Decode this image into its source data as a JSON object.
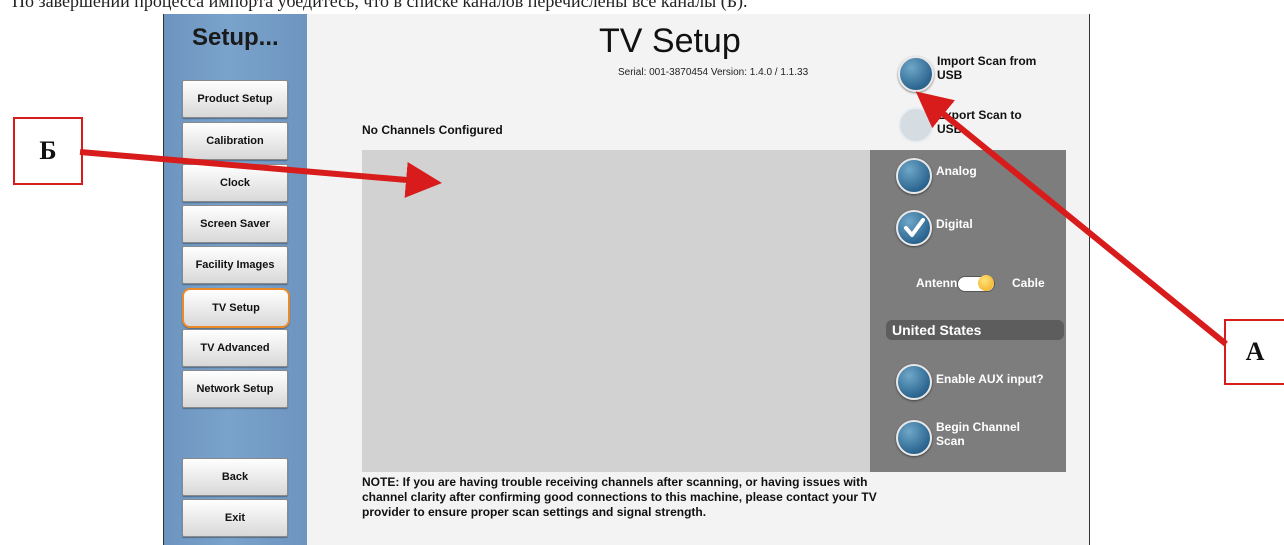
{
  "doc_caption": "По завершении процесса импорта убедитесь, что в списке каналов перечислены все каналы (Б).",
  "sidebar": {
    "title": "Setup...",
    "items": [
      {
        "label": "Product Setup"
      },
      {
        "label": "Calibration"
      },
      {
        "label": "Clock"
      },
      {
        "label": "Screen Saver"
      },
      {
        "label": "Facility Images"
      },
      {
        "label": "TV Setup",
        "active": true
      },
      {
        "label": "TV Advanced"
      },
      {
        "label": "Network Setup"
      }
    ],
    "back_label": "Back",
    "exit_label": "Exit"
  },
  "main": {
    "title": "TV Setup",
    "serial": "Serial: 001-3870454  Version: 1.4.0 / 1.1.33",
    "channels_status": "No Channels Configured",
    "import_label": "Import Scan from USB",
    "export_label": "Export Scan to USB",
    "analog_label": "Analog",
    "digital_label": "Digital",
    "antenna_label": "Antenna",
    "cable_label": "Cable",
    "country": "United States",
    "aux_label": "Enable AUX input?",
    "scan_label": "Begin Channel Scan",
    "note": "NOTE: If you are having trouble receiving channels after scanning, or having issues with channel clarity after confirming good connections to this machine, please contact your TV provider to ensure proper scan settings and signal strength."
  },
  "callouts": {
    "left": "Б",
    "right": "А"
  },
  "colors": {
    "sidebar_blue": "#7aa3cc",
    "active_outline": "#e88a2a",
    "annotation_red": "#d81b1b",
    "panel_gray": "#7d7d7d",
    "button_blue": "#2c6690"
  },
  "icons": [
    "checkmark-icon"
  ]
}
